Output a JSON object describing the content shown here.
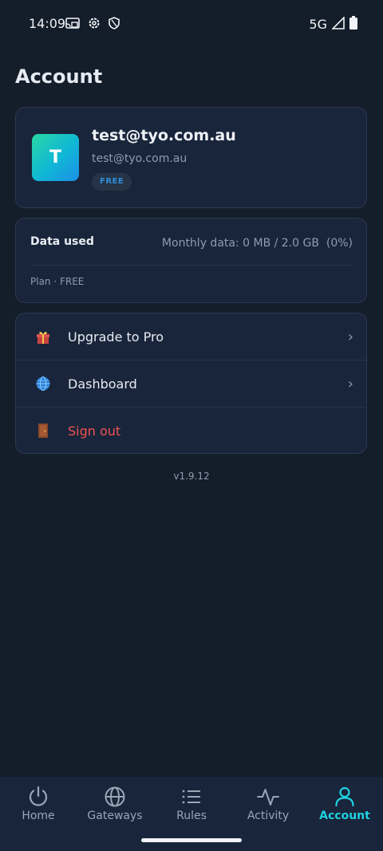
{
  "status_bar": {
    "time": "14:09",
    "network": "5G",
    "icons": [
      "cast-icon",
      "settings-icon",
      "shield-icon",
      "signal-icon",
      "battery-icon"
    ]
  },
  "page": {
    "title": "Account"
  },
  "profile": {
    "avatar_letter": "T",
    "name": "test@tyo.com.au",
    "email": "test@tyo.com.au",
    "plan_badge": "FREE"
  },
  "data_usage": {
    "label": "Data used",
    "value": "Monthly data: 0 MB / 2.0 GB  (0%)",
    "plan": "Plan · FREE"
  },
  "menu": {
    "items": [
      {
        "label": "Upgrade to Pro",
        "icon": "gift-icon",
        "chevron": "›"
      },
      {
        "label": "Dashboard",
        "icon": "globe-icon",
        "chevron": "›"
      },
      {
        "label": "Sign out",
        "icon": "door-icon"
      }
    ]
  },
  "version": "v1.9.12",
  "nav": {
    "active": "Account",
    "active_color": "#1fd0e0",
    "items": [
      {
        "label": "Home",
        "icon": "power-icon"
      },
      {
        "label": "Gateways",
        "icon": "globe-icon"
      },
      {
        "label": "Rules",
        "icon": "list-icon"
      },
      {
        "label": "Activity",
        "icon": "activity-icon"
      },
      {
        "label": "Account",
        "icon": "user-icon"
      }
    ]
  }
}
